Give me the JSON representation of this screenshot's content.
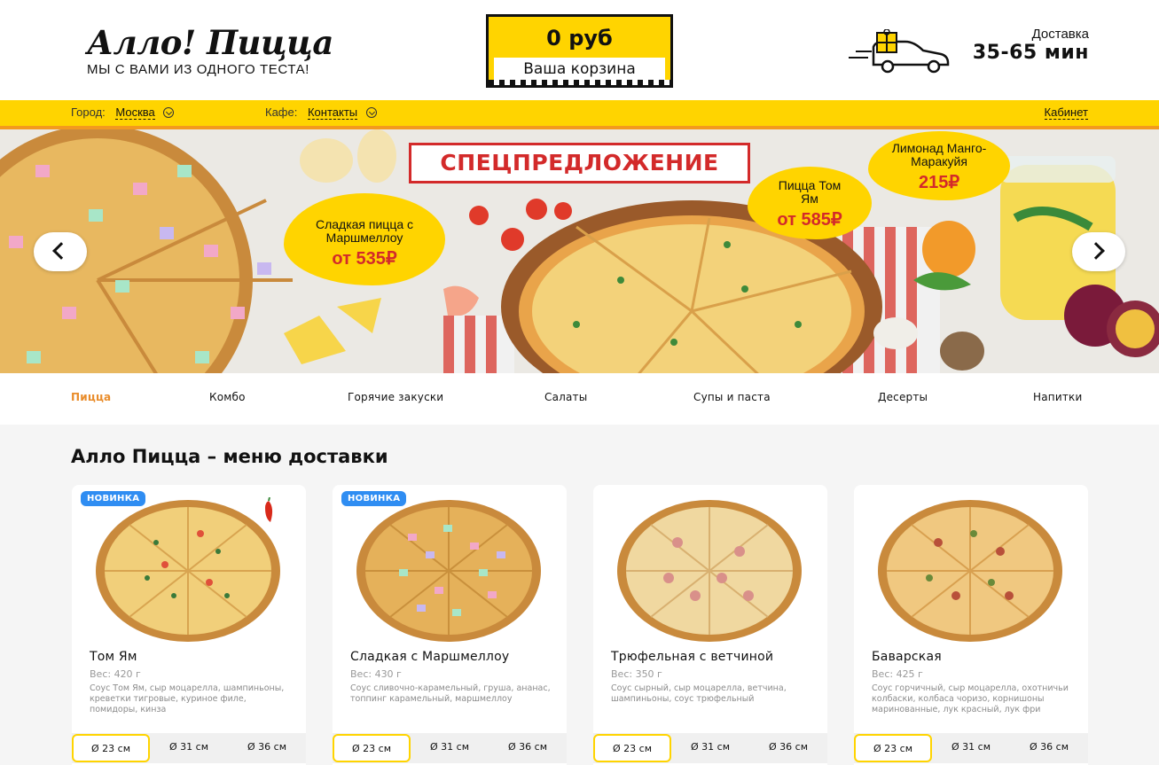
{
  "header": {
    "logo_title": "Алло! Пицца",
    "logo_subtitle": "МЫ С ВАМИ ИЗ ОДНОГО ТЕСТА!",
    "cart_price": "0 руб",
    "cart_label": "Ваша корзина",
    "delivery_label": "Доставка",
    "delivery_time": "35-65 мин"
  },
  "topbar": {
    "city_label": "Город:",
    "city_value": "Москва",
    "cafe_label": "Кафе:",
    "cafe_value": "Контакты",
    "cabinet": "Кабинет"
  },
  "banner": {
    "headline": "СПЕЦПРЕДЛОЖЕНИЕ",
    "offers": [
      {
        "name": "Сладкая пицца с Маршмеллоу",
        "price": "от 535₽"
      },
      {
        "name": "Пицца Том Ям",
        "price": "от 585₽"
      },
      {
        "name": "Лимонад Манго-Маракуйя",
        "price": "215₽"
      }
    ]
  },
  "categories": [
    "Пицца",
    "Комбо",
    "Горячие закуски",
    "Салаты",
    "Супы и паста",
    "Десерты",
    "Напитки"
  ],
  "section_title": "Алло Пицца – меню доставки",
  "products": [
    {
      "badge": "НОВИНКА",
      "name": "Том Ям",
      "weight": "Вес: 420 г",
      "desc": "Соус Том Ям, сыр моцарелла, шампиньоны, креветки тигровые, куриное филе, помидоры, кинза",
      "sizes": [
        "Ø 23 см",
        "Ø 31 см",
        "Ø 36 см"
      ]
    },
    {
      "badge": "НОВИНКА",
      "name": "Сладкая с Маршмеллоу",
      "weight": "Вес: 430 г",
      "desc": "Соус сливочно-карамельный, груша, ананас, топпинг карамельный, маршмеллоу",
      "sizes": [
        "Ø 23 см",
        "Ø 31 см",
        "Ø 36 см"
      ]
    },
    {
      "badge": "",
      "name": "Трюфельная с ветчиной",
      "weight": "Вес: 350 г",
      "desc": "Соус сырный, сыр моцарелла, ветчина, шампиньоны, соус трюфельный",
      "sizes": [
        "Ø 23 см",
        "Ø 31 см",
        "Ø 36 см"
      ]
    },
    {
      "badge": "",
      "name": "Баварская",
      "weight": "Вес: 425 г",
      "desc": "Соус горчичный, сыр моцарелла, охотничьи колбаски, колбаса чоризо, корнишоны маринованные, лук красный, лук фри",
      "sizes": [
        "Ø 23 см",
        "Ø 31 см",
        "Ø 36 см"
      ]
    }
  ],
  "colors": {
    "brand_yellow": "#ffd400",
    "accent_orange": "#e98c2a",
    "promo_red": "#d32a2a",
    "badge_blue": "#2f8df2"
  }
}
